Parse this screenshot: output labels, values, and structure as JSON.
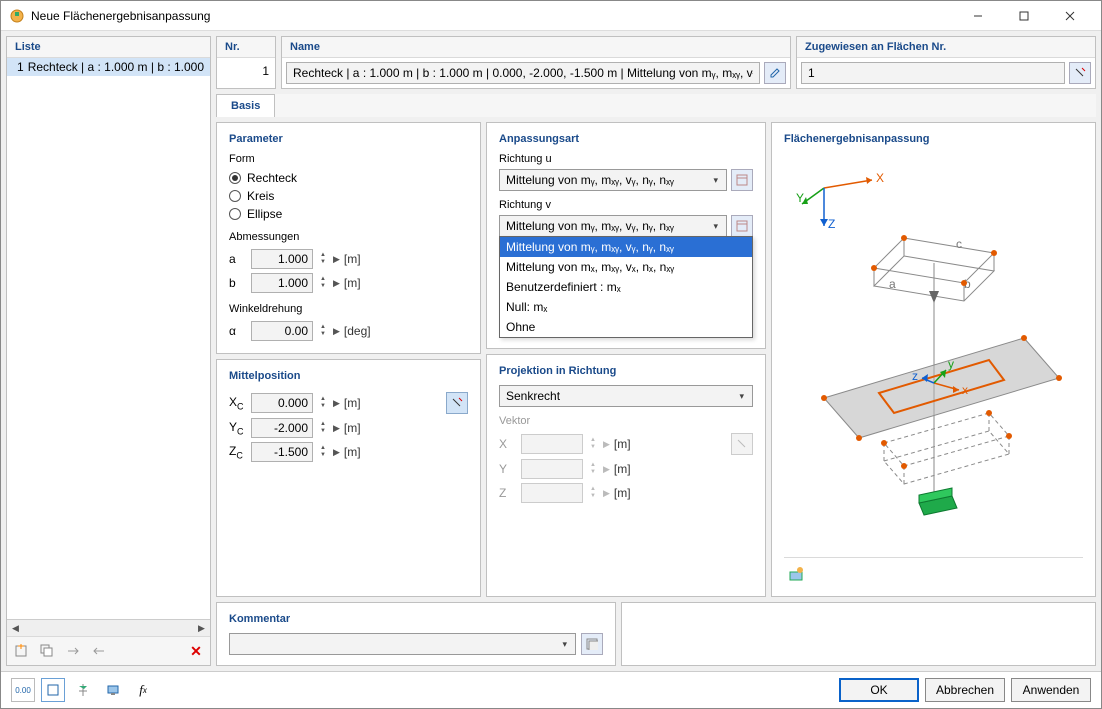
{
  "title": "Neue Flächenergebnisanpassung",
  "list": {
    "header": "Liste",
    "item_num": "1",
    "item_text": "Rechteck | a : 1.000 m | b : 1.000"
  },
  "nr": {
    "header": "Nr.",
    "value": "1"
  },
  "name": {
    "header": "Name",
    "value": "Rechteck | a : 1.000 m | b : 1.000 m | 0.000, -2.000, -1.500 m | Mittelung von mᵧ, mₓᵧ, vᵧ,"
  },
  "assigned": {
    "header": "Zugewiesen an Flächen Nr.",
    "value": "1"
  },
  "tabs": {
    "basis": "Basis"
  },
  "parameter": {
    "title": "Parameter",
    "form_label": "Form",
    "radios": {
      "rechteck": "Rechteck",
      "kreis": "Kreis",
      "ellipse": "Ellipse"
    },
    "abmessungen": "Abmessungen",
    "a_label": "a",
    "a_value": "1.000",
    "a_unit": "[m]",
    "b_label": "b",
    "b_value": "1.000",
    "b_unit": "[m]",
    "winkeldrehung": "Winkeldrehung",
    "alpha_label": "α",
    "alpha_value": "0.00",
    "alpha_unit": "[deg]"
  },
  "mittel": {
    "title": "Mittelposition",
    "xc_label": "Xc",
    "xc_value": "0.000",
    "xc_unit": "[m]",
    "yc_label": "Yc",
    "yc_value": "-2.000",
    "yc_unit": "[m]",
    "zc_label": "Zc",
    "zc_value": "-1.500",
    "zc_unit": "[m]"
  },
  "anpassung": {
    "title": "Anpassungsart",
    "richtung_u": "Richtung u",
    "u_value": "Mittelung von mᵧ, mₓᵧ, vᵧ, nᵧ, nₓᵧ",
    "richtung_v": "Richtung v",
    "v_value": "Mittelung von mᵧ, mₓᵧ, vᵧ, nᵧ, nₓᵧ",
    "options": {
      "o1": "Mittelung von mᵧ, mₓᵧ, vᵧ, nᵧ, nₓᵧ",
      "o2": "Mittelung von mₓ, mₓᵧ, vₓ, nₓ, nₓᵧ",
      "o3": "Benutzerdefiniert : mₓ",
      "o4": "Null: mₓ",
      "o5": "Ohne"
    }
  },
  "projektion": {
    "title": "Projektion in Richtung",
    "value": "Senkrecht",
    "vektor_label": "Vektor",
    "x_label": "X",
    "x_unit": "[m]",
    "y_label": "Y",
    "y_unit": "[m]",
    "z_label": "Z",
    "z_unit": "[m]"
  },
  "preview": {
    "title": "Flächenergebnisanpassung"
  },
  "kommentar": {
    "title": "Kommentar"
  },
  "buttons": {
    "ok": "OK",
    "cancel": "Abbrechen",
    "apply": "Anwenden"
  },
  "axis": {
    "x": "X",
    "y": "Y",
    "z": "Z",
    "a": "a",
    "b": "b",
    "c": "c"
  }
}
